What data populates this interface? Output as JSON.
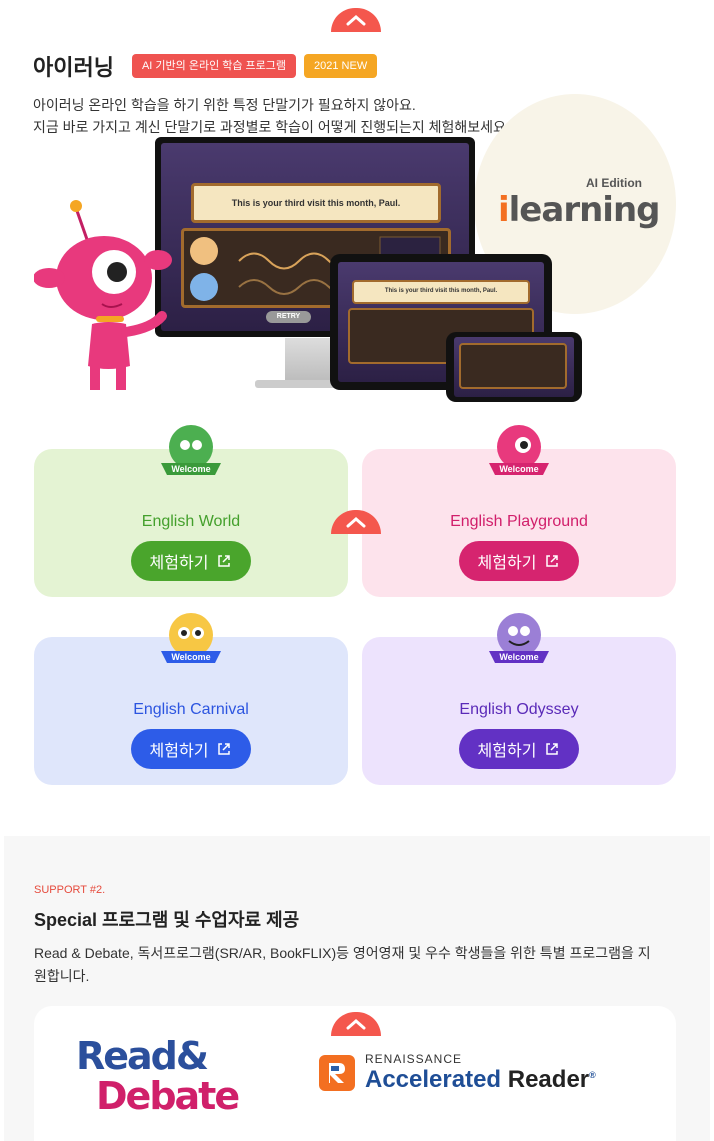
{
  "program": {
    "title": "아이러닝",
    "badge_ai": "AI 기반의 온라인 학습 프로그램",
    "badge_new": "2021 NEW",
    "desc_line1": "아이러닝 온라인 학습을 하기 위한 특정 단말기가 필요하지 않아요.",
    "desc_line2": "지금 바로 가지고 계신 단말기로 과정별로 학습이 어떻게 진행되는지 체험해보세요.",
    "logo_edition": "AI Edition",
    "logo_i": "i",
    "logo_rest": "learning",
    "screen_prompt": "This is your third visit this month, Paul.",
    "screen_retry": "RETRY",
    "tablet_prompt": "This is your third visit this month, Paul."
  },
  "cards": [
    {
      "name": "English World",
      "button": "체험하기",
      "welcome": "Welcome"
    },
    {
      "name": "English Playground",
      "button": "체험하기",
      "welcome": "Welcome"
    },
    {
      "name": "English Carnival",
      "button": "체험하기",
      "welcome": "Welcome"
    },
    {
      "name": "English Odyssey",
      "button": "체험하기",
      "welcome": "Welcome"
    }
  ],
  "support": {
    "tag": "SUPPORT #2.",
    "heading": "Special 프로그램 및 수업자료 제공",
    "text": "Read & Debate, 독서프로그램(SR/AR, BookFLIX)등 영어영재 및 우수 학생들을 위한 특별 프로그램을 지원합니다.",
    "logo_read": "Read&",
    "logo_debate": "Debate",
    "ar_top": "RENAISSANCE",
    "ar_main": "Accelerated",
    "ar_reader": "Reader",
    "ar_mark": "®"
  },
  "colors": {
    "accent": "#f4574d",
    "world": "#4aa52c",
    "playground": "#d6246f",
    "carnival": "#2d5ce8",
    "odyssey": "#6231c4"
  }
}
